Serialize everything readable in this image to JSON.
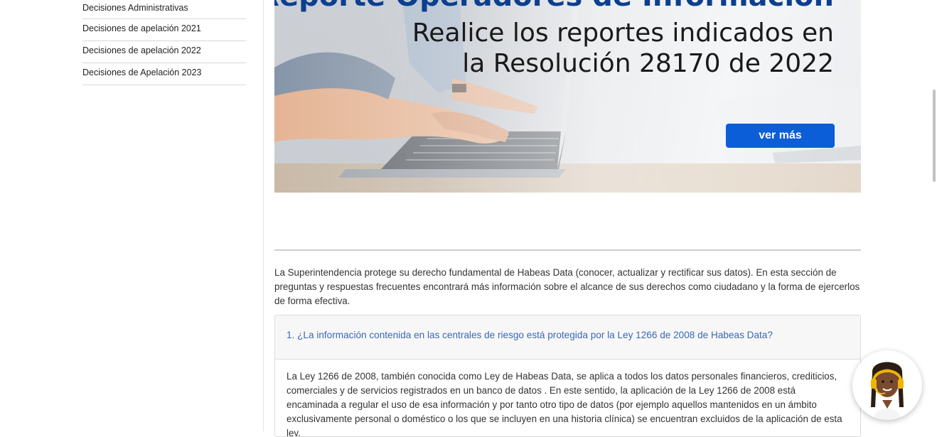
{
  "sidebar": {
    "items": [
      {
        "label": "Decisiones Administrativas"
      },
      {
        "label": "Decisiones de apelación 2021"
      },
      {
        "label": "Decisiones de apelación 2022"
      },
      {
        "label": "Decisiones de Apelación 2023"
      }
    ]
  },
  "banner": {
    "heading": "Reporte Operadores de Información",
    "line1": "Realice los reportes indicados en",
    "line2": "la Resolución 28170 de 2022",
    "button_label": "ver más"
  },
  "intro": {
    "text": "La Superintendencia protege su derecho fundamental de Habeas Data (conocer, actualizar y rectificar sus datos). En esta sección de preguntas y respuestas frecuentes encontrará más información sobre el alcance de sus derechos como ciudadano y la forma de ejercerlos de forma efectiva."
  },
  "faq": {
    "question": "1. ¿La información contenida en las centrales de riesgo está protegida por la Ley 1266 de 2008 de Habeas Data?",
    "answer": "La Ley 1266 de 2008, también conocida como Ley de Habeas Data, se aplica a todos los datos personales financieros, crediticios, comerciales y de servicios registrados en un banco de datos . En este sentido, la aplicación de la Ley 1266 de 2008 está encaminada a regular el uso de esa información y por tanto otro tipo de datos (por ejemplo aquellos mantenidos en un ámbito exclusivamente personal o doméstico o los que se incluyen en una historia clínica) se encuentran excluidos de la aplicación de esta ley."
  },
  "colors": {
    "accent": "#0b5ed7",
    "heading_blue": "#0c3f8e",
    "link_blue": "#3b68b5"
  },
  "icons": {
    "chat": "chat-assistant-avatar-icon"
  }
}
